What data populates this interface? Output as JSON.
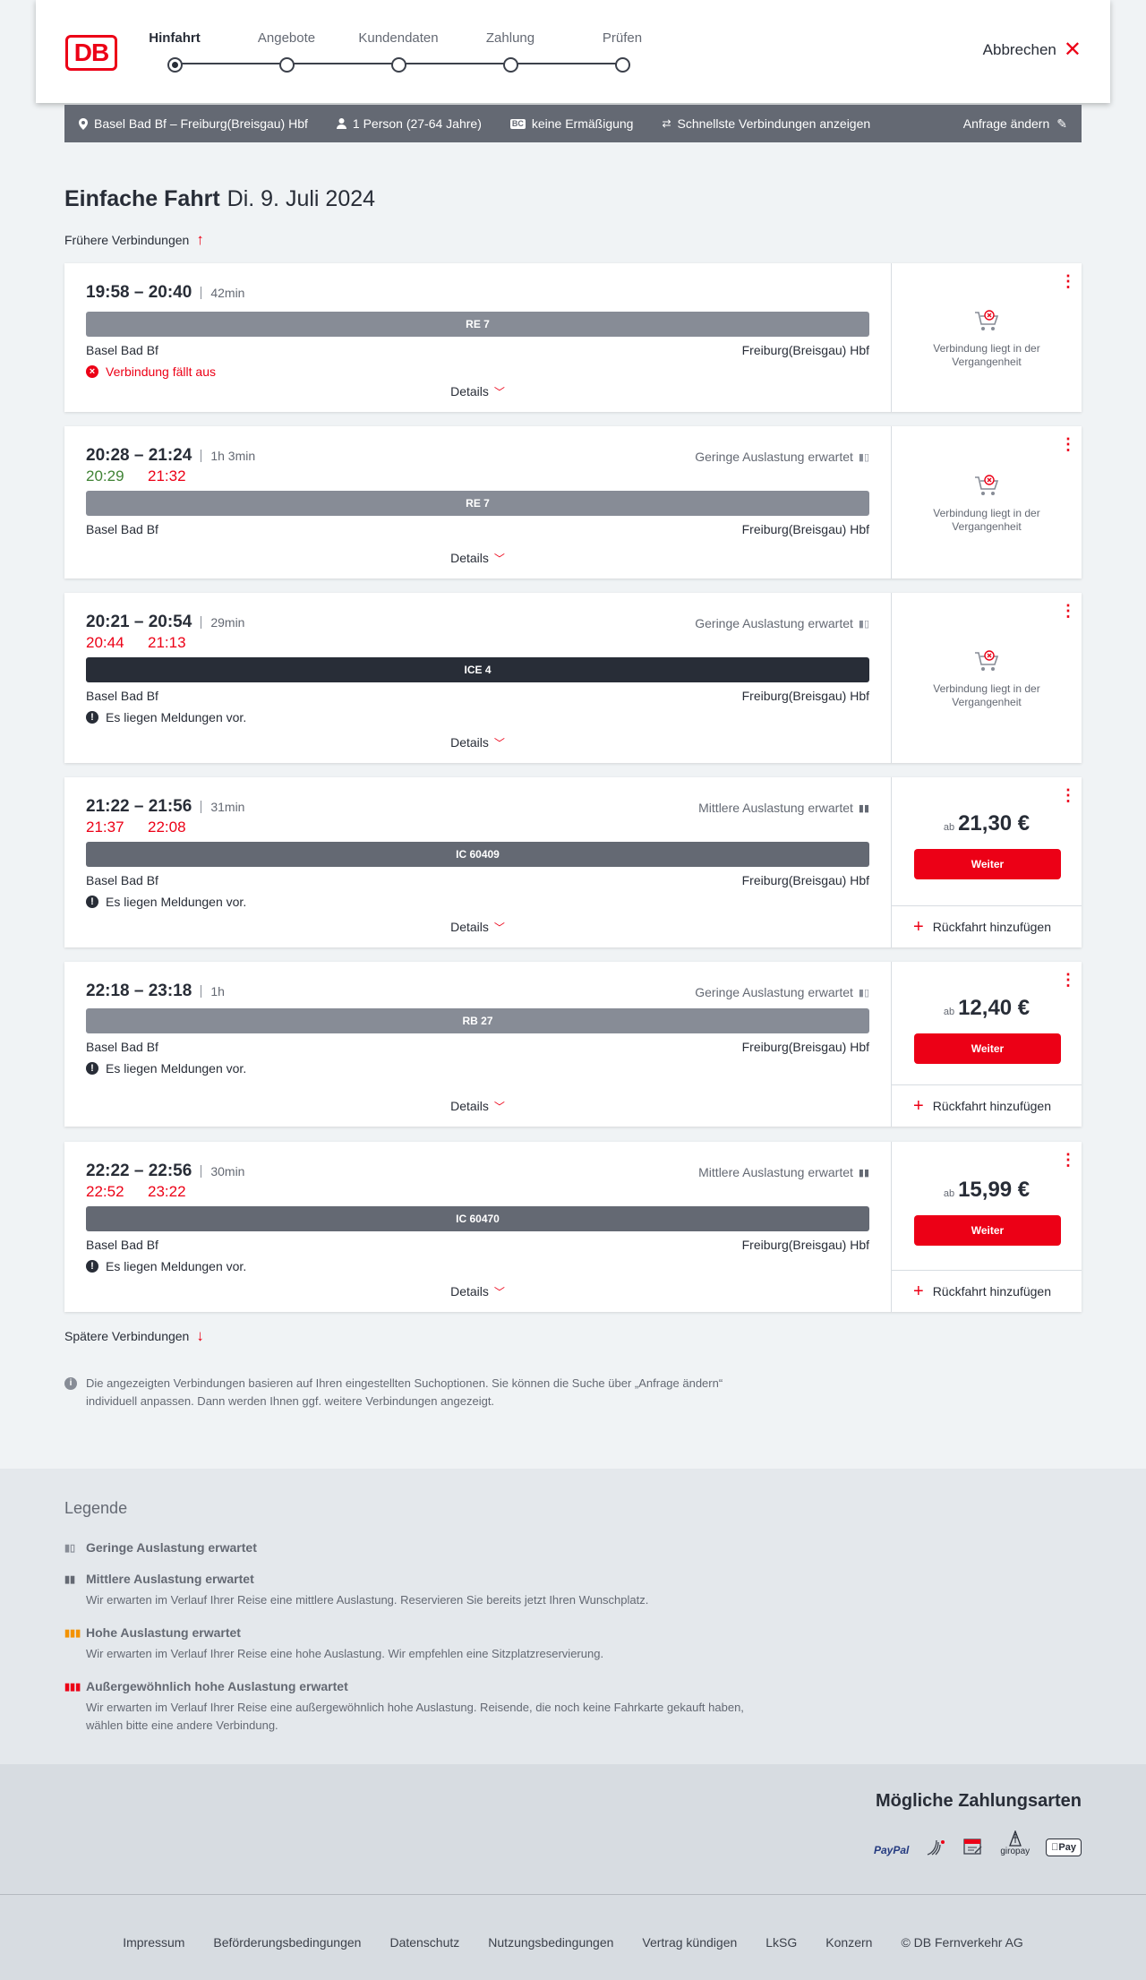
{
  "header": {
    "logo_text": "DB",
    "steps": [
      "Hinfahrt",
      "Angebote",
      "Kundendaten",
      "Zahlung",
      "Prüfen"
    ],
    "active_step": "Hinfahrt",
    "cancel_label": "Abbrechen"
  },
  "search_summary": {
    "route": "Basel Bad Bf – Freiburg(Breisgau) Hbf",
    "travellers": "1 Person (27-64 Jahre)",
    "bc_badge": "BC",
    "discount": "keine Ermäßigung",
    "fastest": "Schnellste Verbindungen anzeigen",
    "change_request": "Anfrage ändern"
  },
  "page": {
    "title": "Einfache Fahrt",
    "date": "Di. 9. Juli 2024",
    "earlier": "Frühere Verbindungen",
    "later": "Spätere Verbindungen",
    "info": "Die angezeigten Verbindungen basieren auf Ihren eingestellten Suchoptionen. Sie können die Suche über „Anfrage ändern“ individuell anpassen. Dann werden Ihnen ggf. weitere Verbindungen angezeigt.",
    "details_label": "Details",
    "past_label": "Verbindung liegt in der Vergangenheit",
    "weiter_label": "Weiter",
    "return_label": "Rückfahrt hinzufügen",
    "price_prefix": "ab"
  },
  "connections": [
    {
      "times": "19:58 – 20:40",
      "duration": "42min",
      "load": "",
      "rt_dep": "",
      "rt_arr": "",
      "train": "RE 7",
      "from": "Basel Bad Bf",
      "to": "Freiburg(Breisgau) Hbf",
      "message": "Verbindung fällt aus",
      "message_type": "cancelled",
      "state": "past",
      "price": ""
    },
    {
      "times": "20:28 – 21:24",
      "duration": "1h 3min",
      "load": "Geringe Auslastung erwartet",
      "rt_dep": "20:29",
      "rt_arr": "21:32",
      "train": "RE 7",
      "from": "Basel Bad Bf",
      "to": "Freiburg(Breisgau) Hbf",
      "message": "",
      "message_type": "",
      "state": "past",
      "price": ""
    },
    {
      "times": "20:21 – 20:54",
      "duration": "29min",
      "load": "Geringe Auslastung erwartet",
      "rt_dep": "20:44",
      "rt_arr": "21:13",
      "train": "ICE 4",
      "from": "Basel Bad Bf",
      "to": "Freiburg(Breisgau) Hbf",
      "message": "Es liegen Meldungen vor.",
      "message_type": "info",
      "state": "past",
      "price": ""
    },
    {
      "times": "21:22 – 21:56",
      "duration": "31min",
      "load": "Mittlere Auslastung erwartet",
      "rt_dep": "21:37",
      "rt_arr": "22:08",
      "train": "IC 60409",
      "from": "Basel Bad Bf",
      "to": "Freiburg(Breisgau) Hbf",
      "message": "Es liegen Meldungen vor.",
      "message_type": "info",
      "state": "bookable",
      "price": "21,30 €"
    },
    {
      "times": "22:18 – 23:18",
      "duration": "1h",
      "load": "Geringe Auslastung erwartet",
      "rt_dep": "",
      "rt_arr": "",
      "train": "RB 27",
      "from": "Basel Bad Bf",
      "to": "Freiburg(Breisgau) Hbf",
      "message": "Es liegen Meldungen vor.",
      "message_type": "info",
      "state": "bookable",
      "price": "12,40 €"
    },
    {
      "times": "22:22 – 22:56",
      "duration": "30min",
      "load": "Mittlere Auslastung erwartet",
      "rt_dep": "22:52",
      "rt_arr": "23:22",
      "train": "IC 60470",
      "from": "Basel Bad Bf",
      "to": "Freiburg(Breisgau) Hbf",
      "message": "Es liegen Meldungen vor.",
      "message_type": "info",
      "state": "bookable",
      "price": "15,99 €"
    }
  ],
  "legend": {
    "title": "Legende",
    "items": [
      {
        "title": "Geringe Auslastung erwartet",
        "text": ""
      },
      {
        "title": "Mittlere Auslastung erwartet",
        "text": "Wir erwarten im Verlauf Ihrer Reise eine mittlere Auslastung. Reservieren Sie bereits jetzt Ihren Wunschplatz."
      },
      {
        "title": "Hohe Auslastung erwartet",
        "text": "Wir erwarten im Verlauf Ihrer Reise eine hohe Auslastung. Wir empfehlen eine Sitzplatzreservierung."
      },
      {
        "title": "Außergewöhnlich hohe Auslastung erwartet",
        "text": "Wir erwarten im Verlauf Ihrer Reise eine außergewöhnlich hohe Auslastung. Reisende, die noch keine Fahrkarte gekauft haben, wählen bitte eine andere Verbindung."
      }
    ]
  },
  "payment": {
    "title": "Mögliche Zahlungsarten",
    "methods": [
      "PayPal",
      "giropay",
      "Pay"
    ]
  },
  "footer": {
    "links": [
      "Impressum",
      "Beförderungsbedingungen",
      "Datenschutz",
      "Nutzungsbedingungen",
      "Vertrag kündigen",
      "LkSG",
      "Konzern",
      "© DB Fernverkehr AG"
    ]
  },
  "colors": {
    "brand": "#ec0016",
    "on_time": "#408335",
    "delay": "#ec0016",
    "bar_gray": "#878c96",
    "bar_dark": "#282d37",
    "bar_mid": "#646973"
  }
}
